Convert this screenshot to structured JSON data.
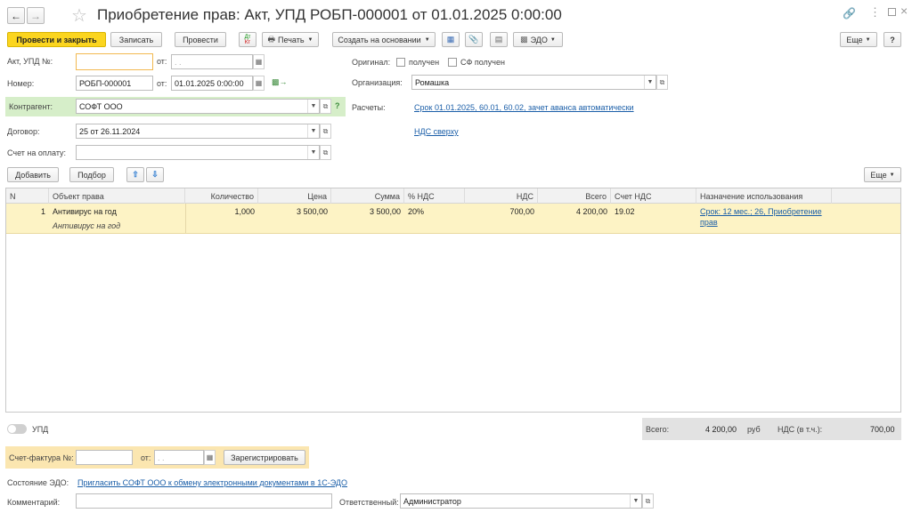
{
  "title": "Приобретение прав: Акт, УПД РОБП-000001 от 01.01.2025 0:00:00",
  "toolbar": {
    "post_close": "Провести и закрыть",
    "save": "Записать",
    "post": "Провести",
    "print": "Печать",
    "create_based": "Создать на основании",
    "edo": "ЭДО",
    "more": "Еще",
    "help": "?"
  },
  "form": {
    "act_label": "Акт, УПД №:",
    "act_value": "",
    "from_label": "от:",
    "act_date_placeholder": ". .",
    "number_label": "Номер:",
    "number_value": "РОБП-000001",
    "number_date": "01.01.2025  0:00:00",
    "original_label": "Оригинал:",
    "received": "получен",
    "sf_received": "СФ получен",
    "org_label": "Организация:",
    "org_value": "Ромашка",
    "contractor_label": "Контрагент:",
    "contractor_value": "СОФТ ООО",
    "q": "?",
    "settlements_label": "Расчеты:",
    "settlements_link": "Срок 01.01.2025, 60.01, 60.02, зачет аванса автоматически",
    "contract_label": "Договор:",
    "contract_value": "25 от 26.11.2024",
    "vat_link": "НДС сверху",
    "invoice_label": "Счет на оплату:",
    "invoice_value": ""
  },
  "table_toolbar": {
    "add": "Добавить",
    "select": "Подбор",
    "more": "Еще"
  },
  "table": {
    "headers": {
      "n": "N",
      "object": "Объект права",
      "qty": "Количество",
      "price": "Цена",
      "sum": "Сумма",
      "vat_rate": "% НДС",
      "vat": "НДС",
      "total": "Всего",
      "vat_account": "Счет НДС",
      "purpose": "Назначение использования"
    },
    "rows": [
      {
        "n": "1",
        "object": "Антивирус на год",
        "object_sub": "Антивирус на год",
        "qty": "1,000",
        "price": "3 500,00",
        "sum": "3 500,00",
        "vat_rate": "20%",
        "vat": "700,00",
        "total": "4 200,00",
        "vat_account": "19.02",
        "purpose_line1": "Срок: 12 мес.; 26, Приобретение",
        "purpose_line2": "прав"
      }
    ]
  },
  "footer": {
    "upd_label": "УПД",
    "total_label": "Всего:",
    "total_value": "4 200,00",
    "currency": "руб",
    "vat_label": "НДС (в т.ч.):",
    "vat_value": "700,00",
    "sf_label": "Счет-фактура №:",
    "sf_from": "от:",
    "sf_date_placeholder": ". .",
    "register": "Зарегистрировать",
    "edo_state_label": "Состояние ЭДО:",
    "edo_state_link": "Пригласить СОФТ ООО к обмену электронными документами в 1С-ЭДО",
    "comment_label": "Комментарий:",
    "comment_value": "",
    "responsible_label": "Ответственный:",
    "responsible_value": "Администратор"
  },
  "colors": {
    "accent": "#fbd51f",
    "row_selected": "#fdf3c5",
    "contractor_bg": "#d6eec9",
    "link": "#1a5ea8"
  }
}
